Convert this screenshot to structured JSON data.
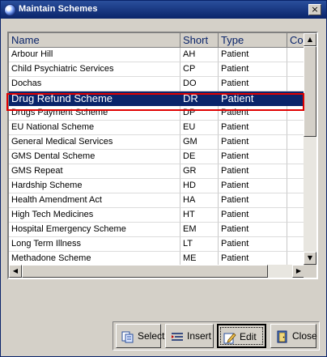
{
  "window": {
    "title": "Maintain Schemes",
    "close_glyph": "×"
  },
  "columns": [
    "Name",
    "Short",
    "Type",
    "Co"
  ],
  "rows": [
    {
      "name": "Arbour Hill",
      "short": "AH",
      "type": "Patient"
    },
    {
      "name": "Child Psychiatric Services",
      "short": "CP",
      "type": "Patient"
    },
    {
      "name": "Dochas",
      "short": "DO",
      "type": "Patient"
    },
    {
      "name": "Drug Refund Scheme",
      "short": "DR",
      "type": "Patient"
    },
    {
      "name": "Drugs Payment Scheme",
      "short": "DP",
      "type": "Patient"
    },
    {
      "name": "EU National Scheme",
      "short": "EU",
      "type": "Patient"
    },
    {
      "name": "General Medical Services",
      "short": "GM",
      "type": "Patient"
    },
    {
      "name": "GMS Dental Scheme",
      "short": "DE",
      "type": "Patient"
    },
    {
      "name": "GMS Repeat",
      "short": "GR",
      "type": "Patient"
    },
    {
      "name": "Hardship Scheme",
      "short": "HD",
      "type": "Patient"
    },
    {
      "name": "Health Amendment Act",
      "short": "HA",
      "type": "Patient"
    },
    {
      "name": "High Tech Medicines",
      "short": "HT",
      "type": "Patient"
    },
    {
      "name": "Hospital Emergency Scheme",
      "short": "EM",
      "type": "Patient"
    },
    {
      "name": "Long Term Illness",
      "short": "LT",
      "type": "Patient"
    },
    {
      "name": "Methadone Scheme",
      "short": "ME",
      "type": "Patient"
    }
  ],
  "selected_row": "Drug Refund Scheme",
  "scroll_glyphs": {
    "up": "▲",
    "down": "▼",
    "left": "◀",
    "right": "▶"
  },
  "buttons": {
    "select": {
      "label": "Select",
      "icon": "select-icon"
    },
    "insert": {
      "label": "Insert",
      "icon": "insert-icon"
    },
    "edit": {
      "label": "Edit",
      "icon": "edit-icon"
    },
    "close": {
      "label": "Close",
      "icon": "close-door-icon"
    }
  },
  "colors": {
    "title_bar": "#0a246a",
    "selection": "#0a246a",
    "selection_outline": "#e00000",
    "face": "#d4d0c8"
  }
}
